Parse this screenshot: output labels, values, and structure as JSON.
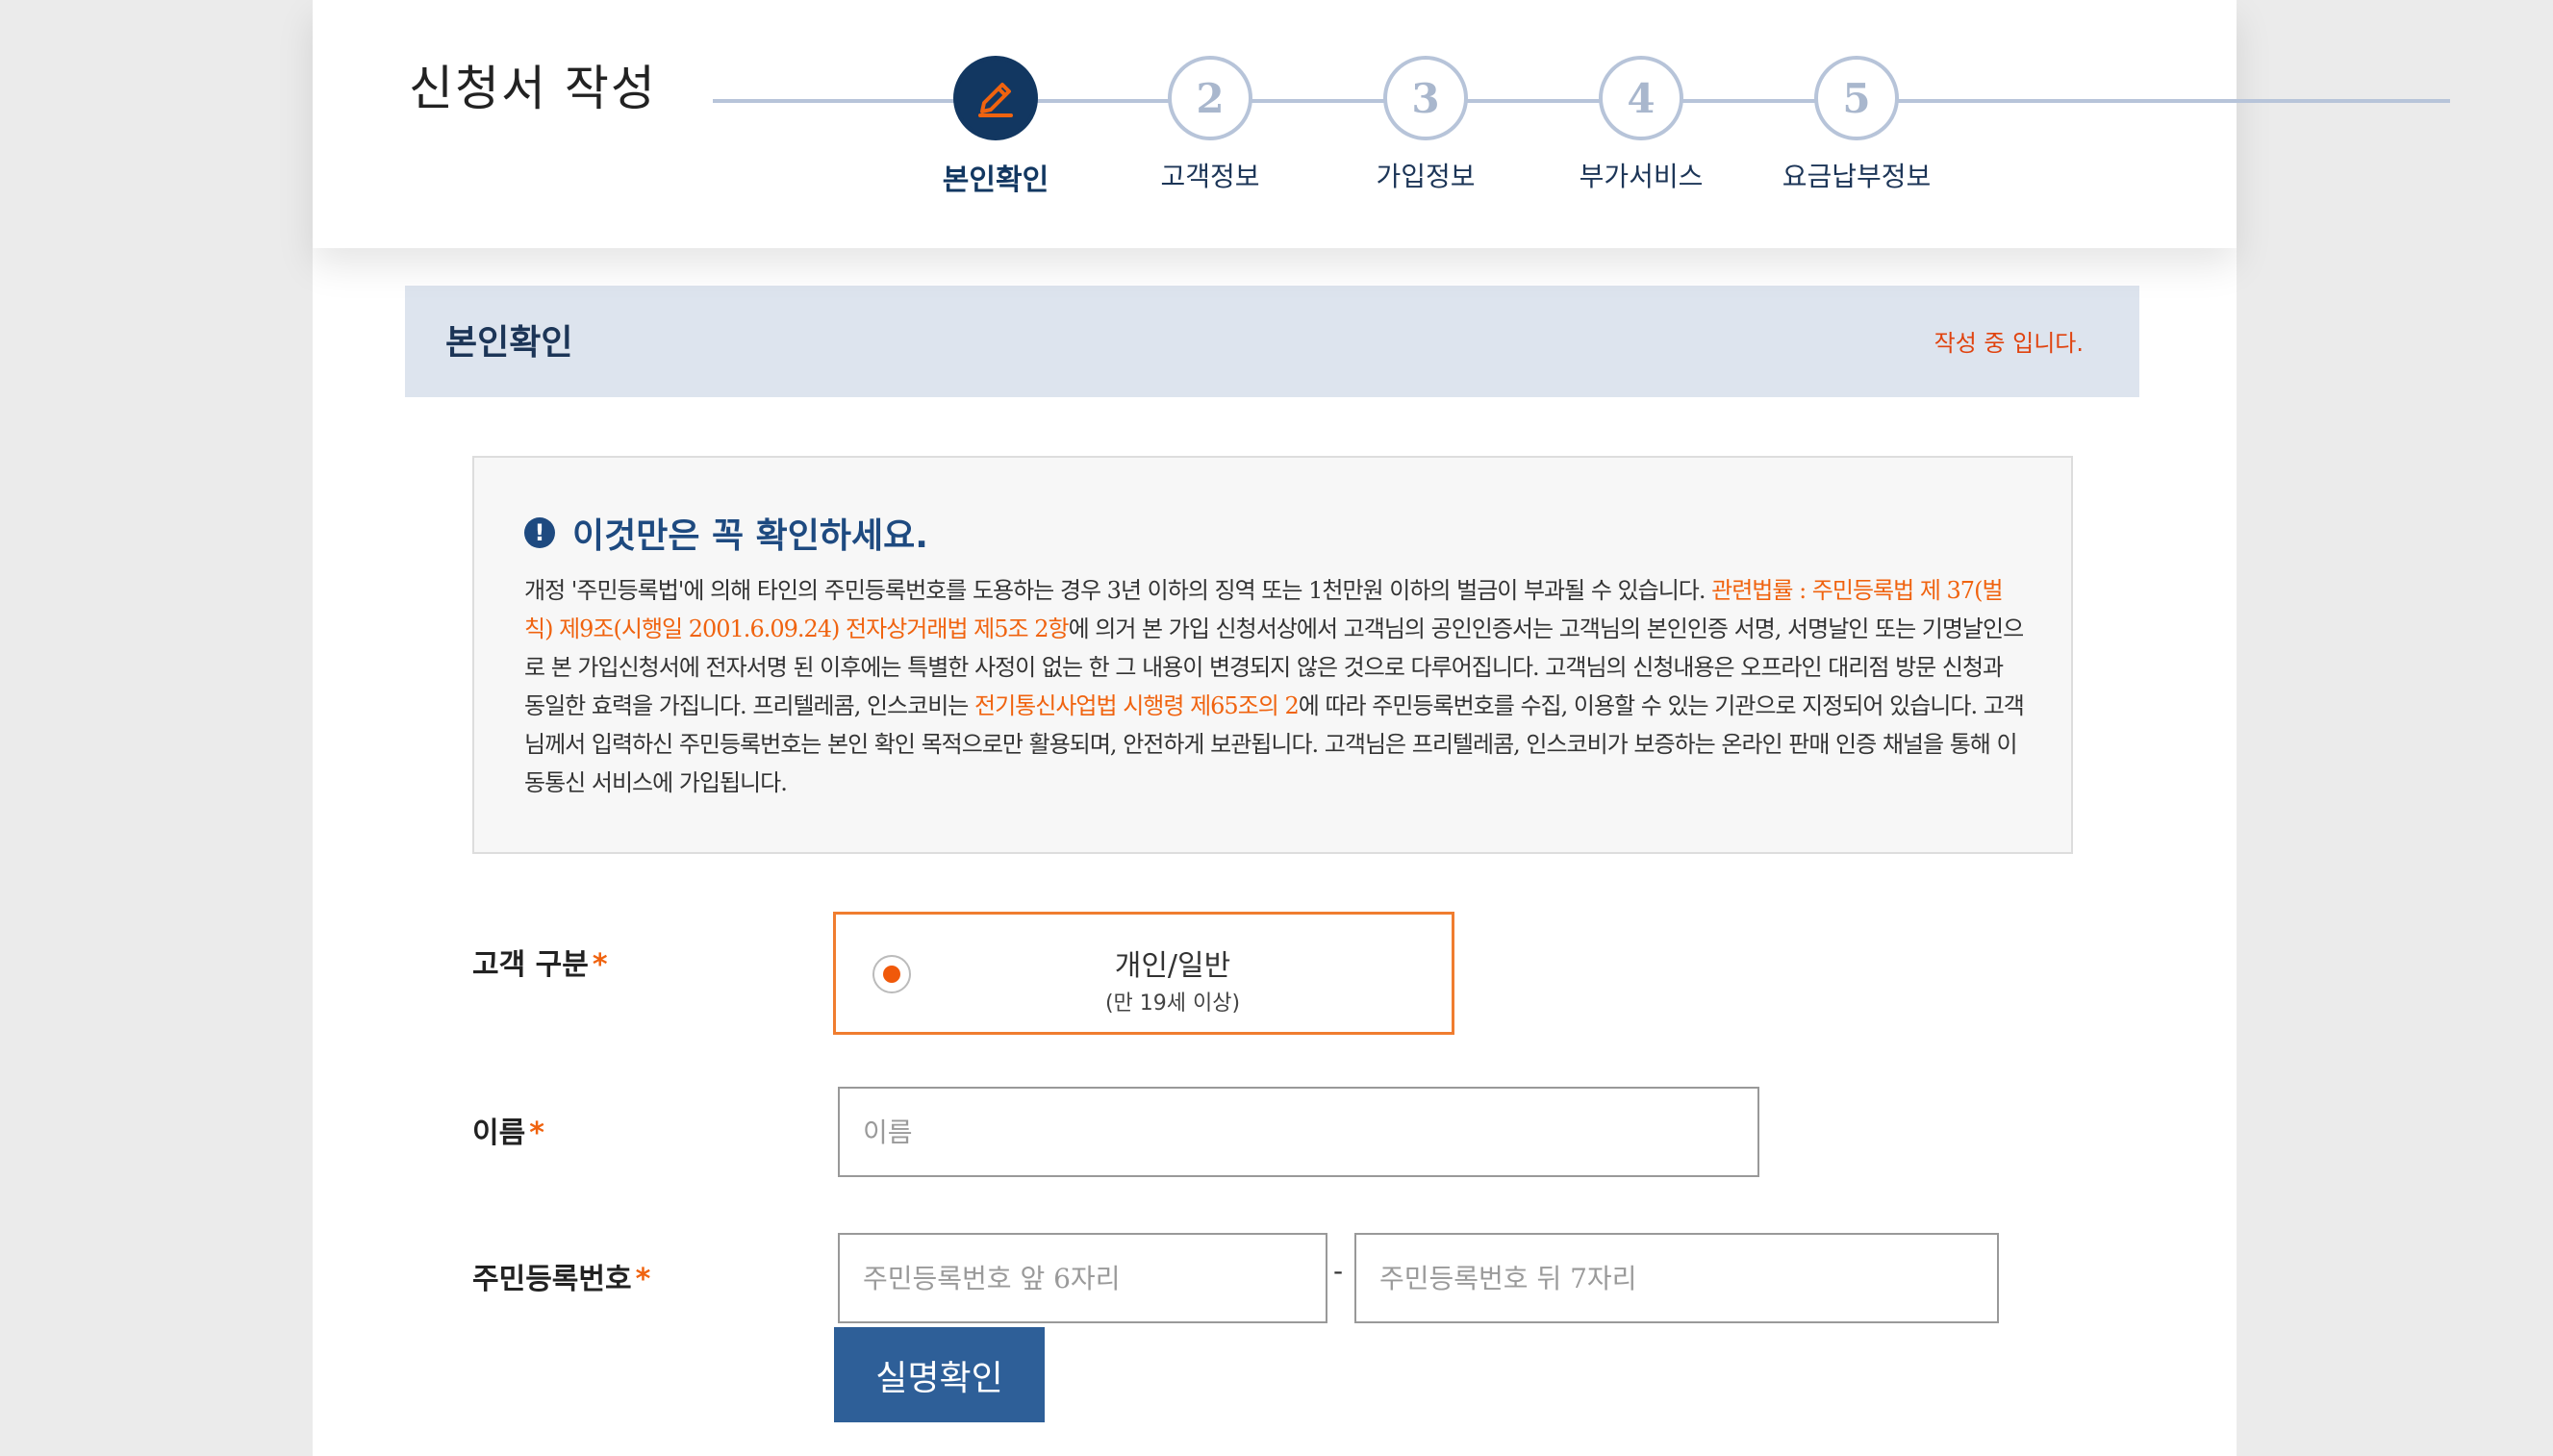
{
  "header": {
    "title": "신청서 작성",
    "steps": [
      {
        "number": "",
        "label": "본인확인",
        "active": true
      },
      {
        "number": "2",
        "label": "고객정보",
        "active": false
      },
      {
        "number": "3",
        "label": "가입정보",
        "active": false
      },
      {
        "number": "4",
        "label": "부가서비스",
        "active": false
      },
      {
        "number": "5",
        "label": "요금납부정보",
        "active": false
      }
    ]
  },
  "section": {
    "title": "본인확인",
    "status": "작성 중 입니다."
  },
  "notice": {
    "title": "이것만은 꼭 확인하세요.",
    "body_1": "개정 '주민등록법'에 의해 타인의 주민등록번호를 도용하는 경우 3년 이하의 징역 또는 1천만원 이하의 벌금이 부과될 수 있습니다. ",
    "body_link_1": "관련법률 : 주민등록법 제 37(벌칙) 제9조(시행일 2001.6.09.24) 전자상거래법 제5조 2항",
    "body_2": "에 의거 본 가입 신청서상에서 고객님의 공인인증서는 고객님의 본인인증 서명, 서명날인 또는 기명날인으로 본 가입신청서에 전자서명 된 이후에는 특별한 사정이 없는 한 그 내용이 변경되지 않은 것으로 다루어집니다. 고객님의 신청내용은 오프라인 대리점 방문 신청과 동일한 효력을 가집니다. 프리텔레콤, 인스코비는 ",
    "body_link_2": "전기통신사업법 시행령 제65조의 2",
    "body_3": "에 따라 주민등록번호를 수집, 이용할 수 있는 기관으로 지정되어 있습니다. 고객님께서 입력하신 주민등록번호는 본인 확인 목적으로만 활용되며, 안전하게 보관됩니다. 고객님은 프리텔레콤, 인스코비가 보증하는 온라인 판매 인증 채널을 통해 이동통신 서비스에 가입됩니다.",
    "icon": "exclamation-circle-icon"
  },
  "form": {
    "customer_type": {
      "label": "고객 구분",
      "required_mark": "*",
      "option_label": "개인/일반",
      "option_sub": "(만 19세 이상)",
      "selected": true
    },
    "name": {
      "label": "이름",
      "required_mark": "*",
      "value": "",
      "placeholder": "이름"
    },
    "rrn": {
      "label": "주민등록번호",
      "required_mark": "*",
      "front_value": "",
      "front_placeholder": "주민등록번호 앞 6자리",
      "separator": "-",
      "back_value": "",
      "back_placeholder": "주민등록번호 뒤 7자리"
    },
    "verify_button": "실명확인"
  },
  "colors": {
    "navy": "#123761",
    "accent_orange": "#f0630f",
    "button_blue": "#2e5f98",
    "section_bg": "#dde4ee"
  }
}
